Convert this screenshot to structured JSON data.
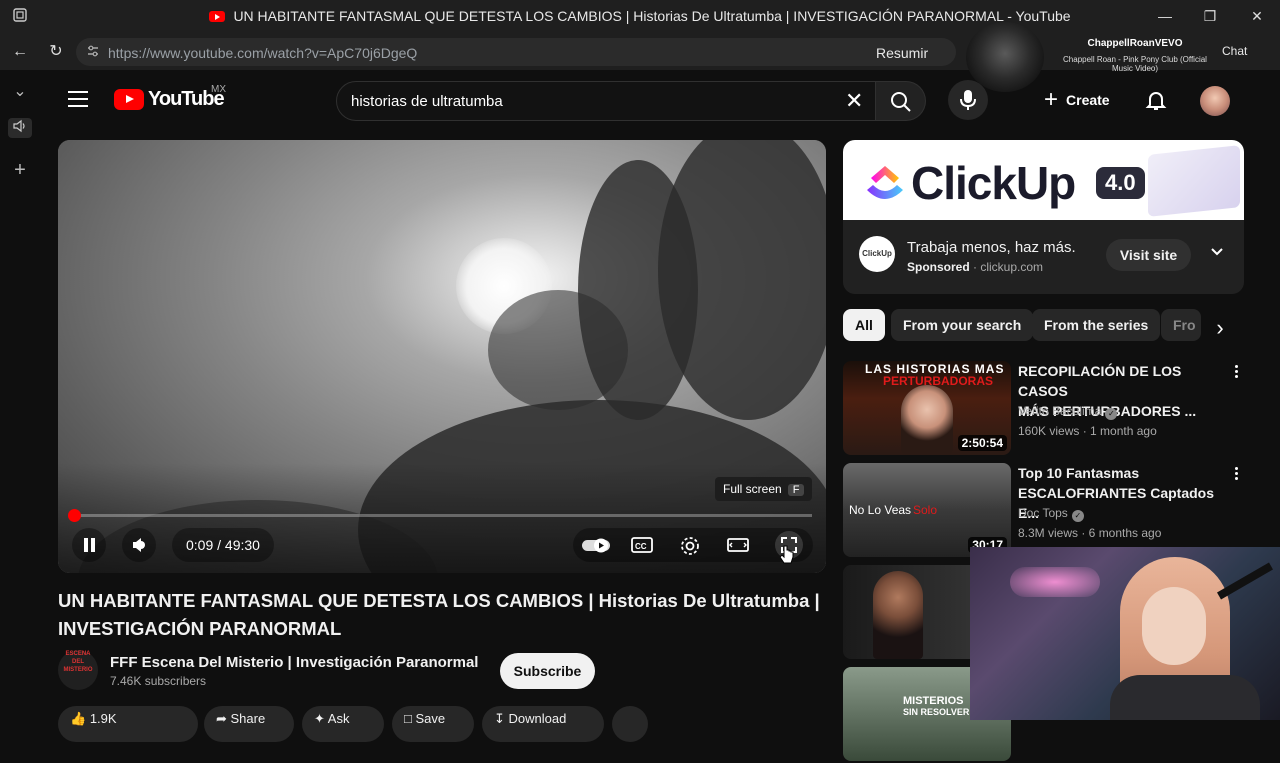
{
  "browser": {
    "window_title": "UN HABITANTE FANTASMAL QUE DETESTA LOS CAMBIOS | Historias De Ultratumba | INVESTIGACIÓN PARANORMAL - YouTube",
    "url": "https://www.youtube.com/watch?v=ApC70j6DgeQ",
    "summarize_label": "Resumir",
    "chat_label": "Chat",
    "now_playing_artist": "ChappellRoanVEVO",
    "now_playing_song": "Chappell Roan - Pink Pony Club (Official Music Video)"
  },
  "header": {
    "logo_text": "YouTube",
    "country_code": "MX",
    "search_value": "historias de ultratumba",
    "create_label": "Create"
  },
  "player": {
    "tooltip_label": "Full screen",
    "tooltip_key": "F",
    "time_display": "0:09 / 49:30",
    "progress_fraction": 0.003
  },
  "video": {
    "title": "UN HABITANTE FANTASMAL QUE DETESTA LOS CAMBIOS | Historias De Ultratumba | INVESTIGACIÓN PARANORMAL",
    "channel_name": "FFF Escena Del Misterio | Investigación Paranormal",
    "channel_avatar_text": "ESCENA DEL MISTERIO",
    "subscribers": "7.46K subscribers",
    "subscribe_label": "Subscribe",
    "actions": [
      "1.9K",
      "",
      "Share",
      "Ask",
      "Save",
      "Download"
    ]
  },
  "ad": {
    "brand": "ClickUp",
    "version": "4.0",
    "logo_text": "ClickUp",
    "headline": "Trabaja menos, haz más.",
    "sponsored_label": "Sponsored",
    "domain": "· clickup.com",
    "cta_label": "Visit site"
  },
  "chips": [
    "All",
    "From your search",
    "From the series",
    "Fro"
  ],
  "recommendations": [
    {
      "title_line1": "RECOPILACIÓN DE LOS CASOS",
      "title_line2": "MÁS PERTURBADORES ...",
      "channel": "Verito Baculima",
      "meta": "160K views · 1 month ago",
      "duration": "2:50:54",
      "thumb_text1": "LAS HISTORIAS MAS",
      "thumb_text2": "PERTURBADORAS"
    },
    {
      "title_line1": "Top 10 Fantasmas",
      "title_line2": "ESCALOFRIANTES Captados E...",
      "channel": "Doc Tops",
      "meta": "8.3M views · 6 months ago",
      "duration": "30:17",
      "thumb_text1": "No Lo Veas",
      "thumb_text2": "Solo"
    }
  ],
  "rec_thumb4_text1": "MISTERIOS",
  "rec_thumb4_text2": "SIN RESOLVER",
  "colors": {
    "brand_red": "#ff0000",
    "background": "#0f0f0f"
  }
}
